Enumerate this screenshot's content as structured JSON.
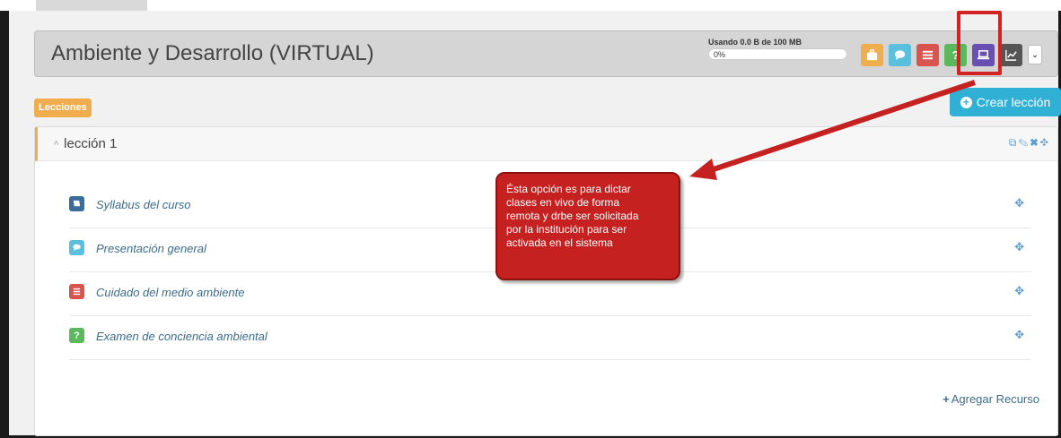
{
  "course": {
    "title": "Ambiente y Desarrollo (VIRTUAL)",
    "usage_text": "Usando 0.0 B de 100 MB",
    "usage_percent": "0%",
    "usage_fraction": 0.0
  },
  "toolbar": {
    "buttons": [
      {
        "name": "briefcase",
        "color": "#f0ad4e"
      },
      {
        "name": "chat",
        "color": "#5bc0de"
      },
      {
        "name": "document",
        "color": "#d9534f"
      },
      {
        "name": "question",
        "color": "#5cb85c",
        "glyph": "?"
      },
      {
        "name": "monitor",
        "color": "#6a4fb3"
      },
      {
        "name": "chart",
        "color": "#555555"
      }
    ]
  },
  "lessons_badge": "Lecciones",
  "create_lesson_label": "Crear lección",
  "lesson": {
    "title": "lección 1",
    "resources": [
      {
        "label": "Syllabus del curso",
        "type": "book",
        "color": "#3a6c9c"
      },
      {
        "label": "Presentación general",
        "type": "chat",
        "color": "#5bc0de"
      },
      {
        "label": "Cuidado del medio ambiente",
        "type": "document",
        "color": "#d9534f"
      },
      {
        "label": "Examen de conciencia ambiental",
        "type": "question",
        "color": "#5cb85c",
        "glyph": "?"
      }
    ],
    "add_resource_label": "Agregar Recurso"
  },
  "callout": {
    "lines": [
      "Ésta opción es para dictar",
      "clases en vivo de forma",
      "remota y drbe ser solicitada",
      "por la institución para ser",
      "activada en el sistema"
    ]
  }
}
